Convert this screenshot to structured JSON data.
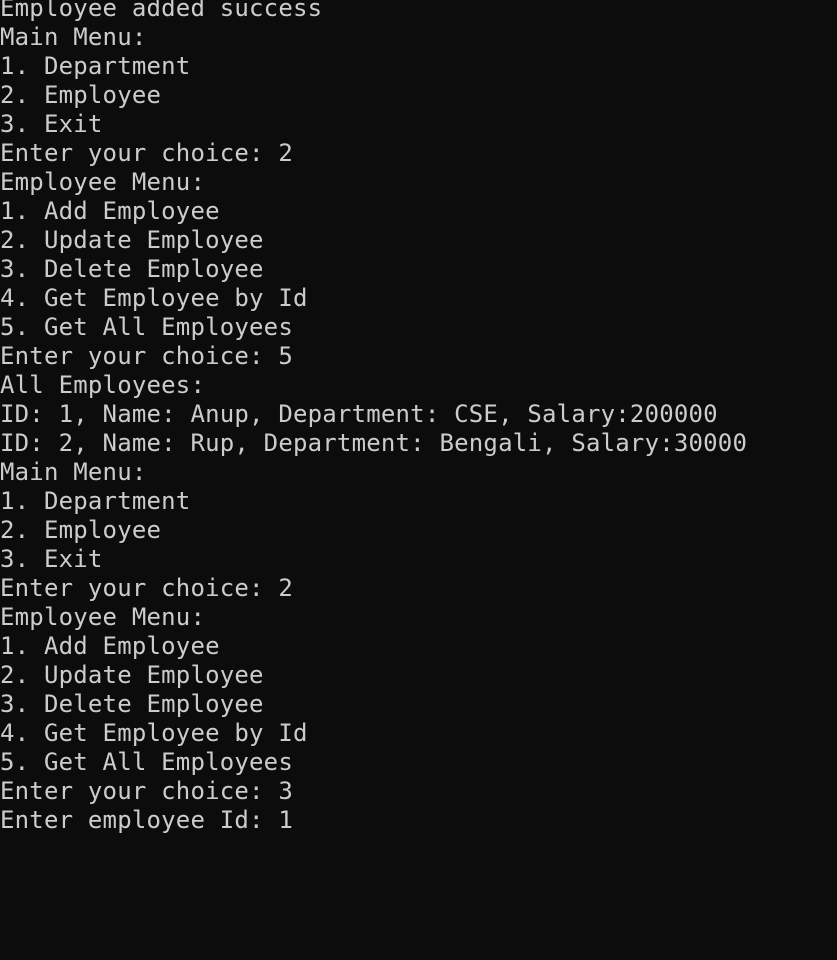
{
  "terminal": {
    "lines": [
      "Employee added success",
      "Main Menu:",
      "1. Department",
      "2. Employee",
      "3. Exit",
      "Enter your choice: 2",
      "Employee Menu:",
      "1. Add Employee",
      "2. Update Employee",
      "3. Delete Employee",
      "4. Get Employee by Id",
      "5. Get All Employees",
      "Enter your choice: 5",
      "All Employees:",
      "ID: 1, Name: Anup, Department: CSE, Salary:200000",
      "ID: 2, Name: Rup, Department: Bengali, Salary:30000",
      "Main Menu:",
      "1. Department",
      "2. Employee",
      "3. Exit",
      "Enter your choice: 2",
      "Employee Menu:",
      "1. Add Employee",
      "2. Update Employee",
      "3. Delete Employee",
      "4. Get Employee by Id",
      "5. Get All Employees",
      "Enter your choice: 3",
      "Enter employee Id: 1"
    ]
  },
  "colors": {
    "background": "#0c0c0c",
    "foreground": "#cccccc"
  }
}
